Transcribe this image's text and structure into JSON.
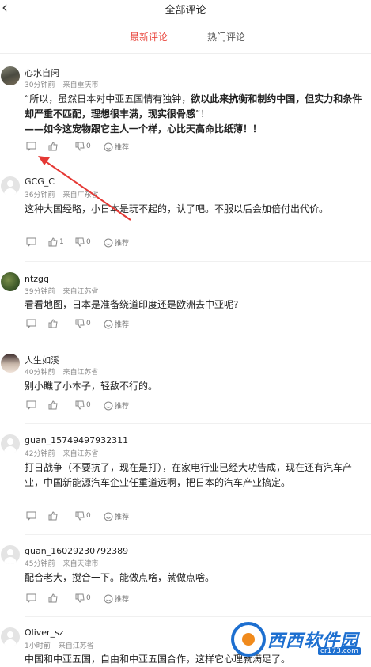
{
  "header": {
    "back_icon": "chevron-left-icon",
    "title": "全部评论"
  },
  "tabs": {
    "latest": "最新评论",
    "hot": "热门评论",
    "active_color": "#e8453c"
  },
  "actions": {
    "recommend": "推荐"
  },
  "comments": [
    {
      "user": "心水自闲",
      "time": "30分钟前",
      "location": "来自重庆市",
      "text_parts": [
        "“所以，虽然日本对中亚五国情有独钟，",
        "欲以此来抗衡和制约中国，但实力和条件却严重不匹配，理想很丰满，现实很骨感",
        "”！",
        "——如今这宠物跟它主人一个样，心比天高命比纸薄！！"
      ],
      "likes": "0",
      "dislikes": "0",
      "likes_shown": false
    },
    {
      "user": "GCG_C",
      "time": "36分钟前",
      "location": "来自广东省",
      "text": "这种大国经略，小日本是玩不起的，认了吧。不服以后会加倍付出代价。",
      "likes": "1",
      "dislikes": "0",
      "likes_shown": true
    },
    {
      "user": "ntzgq",
      "time": "39分钟前",
      "location": "来自江苏省",
      "text": "看看地图，日本是准备绕道印度还是欧洲去中亚呢?",
      "likes": "0",
      "dislikes": "0",
      "likes_shown": false
    },
    {
      "user": "人生如溪",
      "time": "40分钟前",
      "location": "来自江苏省",
      "text": "别小瞧了小本子，轻敌不行的。",
      "likes": "0",
      "dislikes": "0",
      "likes_shown": false
    },
    {
      "user": "guan_15749497932311",
      "time": "42分钟前",
      "location": "来自江苏省",
      "text": "打日战争（不要抗了，现在是打），在家电行业已经大功告成，现在还有汽车产业，中国新能源汽车企业任重道远啊，把日本的汽车产业搞定。",
      "likes": "0",
      "dislikes": "0",
      "likes_shown": false
    },
    {
      "user": "guan_16029230792389",
      "time": "45分钟前",
      "location": "来自天津市",
      "text": "配合老大，搅合一下。能做点啥，就做点啥。",
      "likes": "0",
      "dislikes": "0",
      "likes_shown": false
    },
    {
      "user": "Oliver_sz",
      "time": "1小时前",
      "location": "来自江苏省",
      "text": "中国和中亚五国，自由和中亚五国合作，这样它心理就满足了。"
    }
  ],
  "watermark": {
    "brand": "西西软件园",
    "url": "cr173.com"
  }
}
